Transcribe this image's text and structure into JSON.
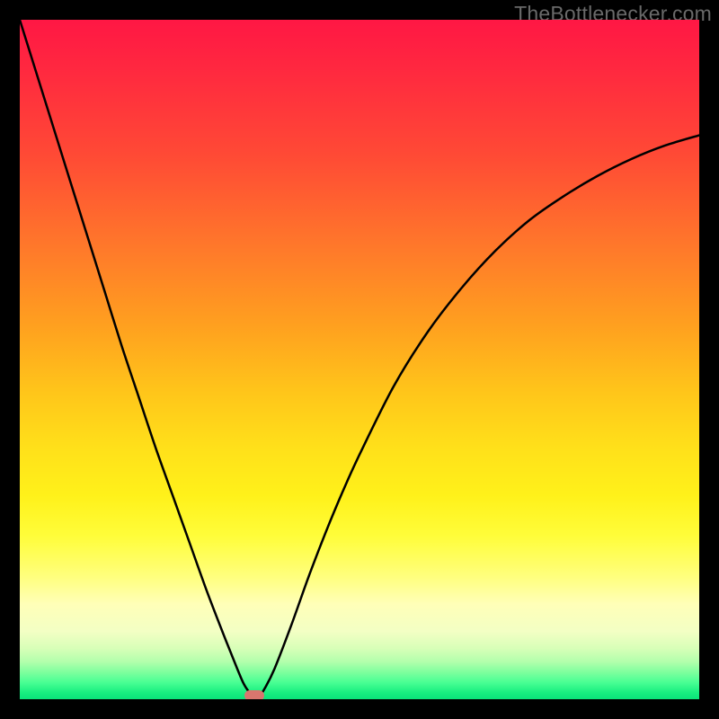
{
  "attribution": "TheBottlenecker.com",
  "chart_data": {
    "type": "line",
    "title": "",
    "xlabel": "",
    "ylabel": "",
    "xlim": [
      0,
      100
    ],
    "ylim": [
      0,
      100
    ],
    "x": [
      0,
      2.5,
      5,
      7.5,
      10,
      12.5,
      15,
      17.5,
      20,
      22.5,
      25,
      27.5,
      30,
      32,
      33,
      34,
      35,
      36,
      37.5,
      40,
      42.5,
      45,
      47.5,
      50,
      55,
      60,
      65,
      70,
      75,
      80,
      85,
      90,
      95,
      100
    ],
    "values": [
      100,
      92,
      84,
      76,
      68,
      60,
      52,
      44.5,
      37,
      30,
      23,
      16,
      9.5,
      4.5,
      2.2,
      0.8,
      0.2,
      1.5,
      4.5,
      11,
      18,
      24.5,
      30.5,
      36,
      46,
      54,
      60.5,
      66,
      70.5,
      74,
      77,
      79.5,
      81.5,
      83
    ],
    "min_marker": {
      "x": 34.5,
      "y": 0.5
    },
    "gradient_stops": [
      {
        "pos": 0.0,
        "color": "#ff1744"
      },
      {
        "pos": 0.45,
        "color": "#ffa01f"
      },
      {
        "pos": 0.76,
        "color": "#fffd3a"
      },
      {
        "pos": 0.97,
        "color": "#4aff94"
      },
      {
        "pos": 1.0,
        "color": "#0ae37a"
      }
    ]
  }
}
